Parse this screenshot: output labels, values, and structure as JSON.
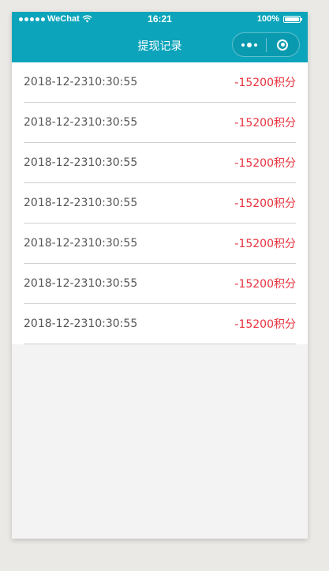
{
  "status_bar": {
    "carrier": "WeChat",
    "time": "16:21",
    "battery_percent": "100%"
  },
  "nav": {
    "title": "提现记录"
  },
  "records": [
    {
      "date": "2018-12-2310:30:55",
      "amount": "-15200积分"
    },
    {
      "date": "2018-12-2310:30:55",
      "amount": "-15200积分"
    },
    {
      "date": "2018-12-2310:30:55",
      "amount": "-15200积分"
    },
    {
      "date": "2018-12-2310:30:55",
      "amount": "-15200积分"
    },
    {
      "date": "2018-12-2310:30:55",
      "amount": "-15200积分"
    },
    {
      "date": "2018-12-2310:30:55",
      "amount": "-15200积分"
    },
    {
      "date": "2018-12-2310:30:55",
      "amount": "-15200积分"
    }
  ],
  "colors": {
    "brand": "#0ba4bb",
    "amount": "#e8323d",
    "date_text": "#555555"
  }
}
